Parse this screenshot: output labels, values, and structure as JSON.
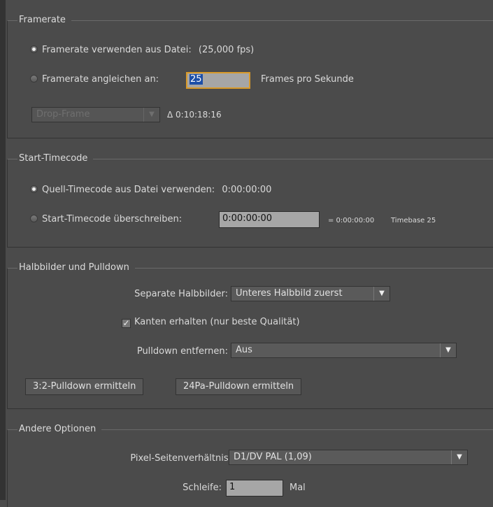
{
  "framerate": {
    "title": "Framerate",
    "use_file_label": "Framerate verwenden aus Datei:",
    "file_fps": "(25,000 fps)",
    "conform_label": "Framerate angleichen an:",
    "conform_value": "25",
    "fps_unit": "Frames pro Sekunde",
    "dropframe_value": "Drop-Frame",
    "delta": "Δ 0:10:18:16"
  },
  "timecode": {
    "title": "Start-Timecode",
    "use_source_label": "Quell-Timecode aus Datei verwenden:",
    "source_value": "0:00:00:00",
    "override_label": "Start-Timecode überschreiben:",
    "override_value": "0:00:00:00",
    "result": "= 0:00:00:00",
    "timebase": "Timebase 25"
  },
  "fields": {
    "title": "Halbbilder und Pulldown",
    "separate_label": "Separate Halbbilder:",
    "separate_value": "Unteres Halbbild zuerst",
    "preserve_edges_label": "Kanten erhalten (nur beste Qualität)",
    "remove_pulldown_label": "Pulldown entfernen:",
    "remove_pulldown_value": "Aus",
    "detect_32_button": "3:2-Pulldown ermitteln",
    "detect_24pa_button": "24Pa-Pulldown ermitteln"
  },
  "other": {
    "title": "Andere Optionen",
    "pixel_aspect_label": "Pixel-Seitenverhältnis:",
    "pixel_aspect_value": "D1/DV PAL (1,09)",
    "loop_label": "Schleife:",
    "loop_value": "1",
    "loop_unit": "Mal"
  }
}
